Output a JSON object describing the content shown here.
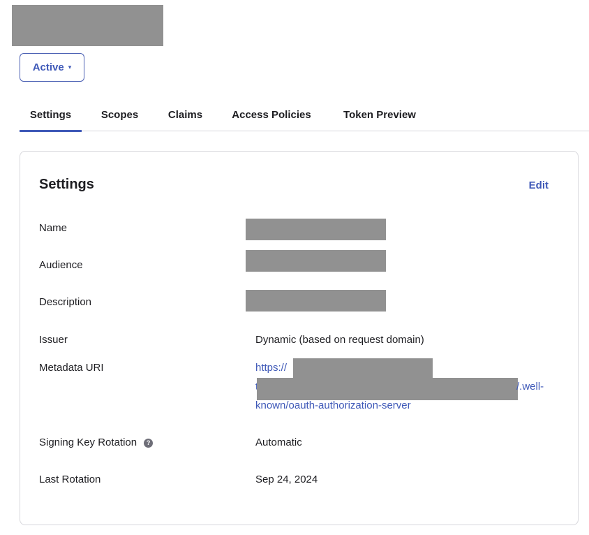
{
  "header": {
    "status_label": "Active",
    "status_caret": "▾"
  },
  "tabs": [
    {
      "label": "Settings"
    },
    {
      "label": "Scopes"
    },
    {
      "label": "Claims"
    },
    {
      "label": "Access Policies"
    },
    {
      "label": "Token Preview"
    }
  ],
  "settings_card": {
    "title": "Settings",
    "edit_label": "Edit",
    "fields": {
      "name": {
        "label": "Name"
      },
      "audience": {
        "label": "Audience"
      },
      "description": {
        "label": "Description"
      },
      "issuer": {
        "label": "Issuer",
        "value": "Dynamic (based on request domain)"
      },
      "metadata_uri": {
        "label": "Metadata URI",
        "line1": "https://",
        "line2_prefix": "t",
        "line2_suffix": "/.well-",
        "line3": "known/oauth-authorization-server"
      },
      "signing_key_rotation": {
        "label": "Signing Key Rotation",
        "help_icon": "?",
        "value": "Automatic"
      },
      "last_rotation": {
        "label": "Last Rotation",
        "value": "Sep 24, 2024"
      }
    }
  },
  "colors": {
    "accent": "#3f59b8",
    "redaction": "#919191",
    "border": "#d7d7dc",
    "text": "#1d1d21"
  }
}
